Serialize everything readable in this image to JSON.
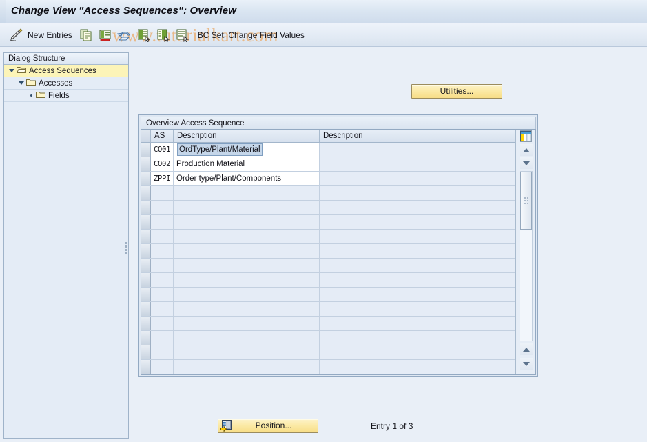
{
  "window": {
    "title": "Change View \"Access Sequences\": Overview",
    "watermark": "www.tutorialkart.com"
  },
  "toolbar": {
    "edit_icon": "pencil-edit-icon",
    "new_entries_label": "New Entries",
    "copy_icon": "copy-icon",
    "delete_icon": "delete-row-icon",
    "undo_icon": "undo-icon",
    "select_all_icon": "select-all-icon",
    "deselect_all_icon": "deselect-all-icon",
    "select_block_icon": "select-block-icon",
    "bc_set_label": "BC Set: Change Field Values"
  },
  "sidebar": {
    "header": "Dialog Structure",
    "items": [
      {
        "label": "Access Sequences",
        "icon": "open-folder-icon",
        "selected": true,
        "level": 0,
        "twisty": "expanded"
      },
      {
        "label": "Accesses",
        "icon": "folder-icon",
        "selected": false,
        "level": 1,
        "twisty": "expanded"
      },
      {
        "label": "Fields",
        "icon": "folder-icon",
        "selected": false,
        "level": 2,
        "twisty": "leaf"
      }
    ]
  },
  "main": {
    "utilities_button": "Utilities...",
    "position_button": "Position...",
    "position_icon": "position-jump-icon",
    "entry_status": "Entry 1 of 3"
  },
  "table": {
    "caption": "Overview Access Sequence",
    "config_icon": "column-config-icon",
    "columns": [
      {
        "key": "selector",
        "label": ""
      },
      {
        "key": "as",
        "label": "AS"
      },
      {
        "key": "desc1",
        "label": "Description"
      },
      {
        "key": "desc2",
        "label": "Description"
      }
    ],
    "rows": [
      {
        "as": "CO01",
        "desc1": "OrdType/Plant/Material",
        "desc2": "",
        "selected": true
      },
      {
        "as": "CO02",
        "desc1": "Production Material",
        "desc2": "",
        "selected": false
      },
      {
        "as": "ZPPI",
        "desc1": "Order type/Plant/Components",
        "desc2": "",
        "selected": false
      }
    ],
    "empty_row_count": 14
  },
  "colors": {
    "accent_button": "#f7dd86",
    "tree_selected": "#fcf4b8",
    "watermark": "#e8b98a",
    "cell_selected": "#c5d6e9",
    "background": "#e9eff7"
  }
}
